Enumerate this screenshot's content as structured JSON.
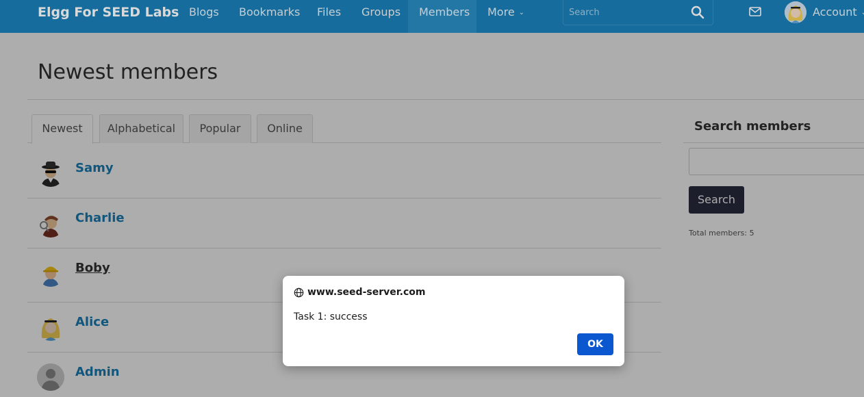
{
  "nav": {
    "brand": "Elgg For SEED Labs",
    "items": [
      {
        "label": "Blogs"
      },
      {
        "label": "Bookmarks"
      },
      {
        "label": "Files"
      },
      {
        "label": "Groups"
      },
      {
        "label": "Members",
        "active": true
      },
      {
        "label": "More"
      }
    ],
    "search_placeholder": "Search",
    "account_label": "Account",
    "colors": {
      "bar": "#1a7fb8",
      "active": "#2a8cc2"
    }
  },
  "page": {
    "title": "Newest members",
    "tabs": [
      {
        "label": "Newest",
        "active": true
      },
      {
        "label": "Alphabetical"
      },
      {
        "label": "Popular"
      },
      {
        "label": "Online"
      }
    ],
    "members": [
      {
        "name": "Samy",
        "icon": "spy-avatar-icon"
      },
      {
        "name": "Charlie",
        "icon": "detective-avatar-icon"
      },
      {
        "name": "Boby",
        "icon": "builder-avatar-icon",
        "hover": true
      },
      {
        "name": "Alice",
        "icon": "alice-avatar-icon"
      },
      {
        "name": "Admin",
        "icon": "default-user-avatar-icon"
      }
    ]
  },
  "sidebar": {
    "title": "Search members",
    "input_value": "",
    "button_label": "Search",
    "total": "Total members: 5"
  },
  "dialog": {
    "origin": "www.seed-server.com",
    "message": "Task 1: success",
    "ok_label": "OK",
    "colors": {
      "ok": "#0b57d0"
    }
  }
}
